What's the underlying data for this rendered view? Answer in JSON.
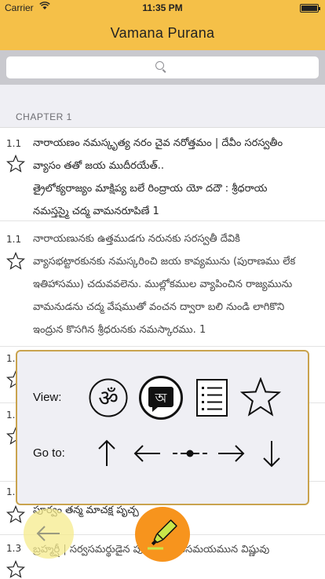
{
  "status_bar": {
    "carrier": "Carrier",
    "time": "11:35 PM"
  },
  "nav": {
    "title": "Vamana Purana"
  },
  "search": {
    "placeholder": ""
  },
  "chapter": {
    "header": "CHAPTER 1"
  },
  "verses": [
    {
      "number": "1.1",
      "lines": [
        "నారాయణం నమస్కృత్య నరం చైవ నరోత్తమం | దేవీం సరస్వతీం",
        "వ్యాసం తతో జయ ముదీరయేత్..",
        "త్రైలోక్యరాజ్యం మాక్షిప్య బలే రింద్రాయ యో దదౌ : శ్రీధరాయ",
        "నమస్తస్మై చద్మ వామనరూపిణే 1"
      ]
    },
    {
      "number": "1.1",
      "lines": [
        "నారాయణునకు ఉత్తముడగు నరునకు సరస్వతీ దేవికి",
        "వ్యాసభట్టారకునకు నమస్కరించి జయ కావ్యమును (పురాణము లేక",
        "ఇతిహాసము) చదువవలెను. ముల్లోకముల వ్యాపించిన రాజ్యమును",
        "వామనుడను చద్మ వేషముతో వంచన ద్వారా బలి నుండి లాగికొని",
        "ఇంద్రున కొసగిన శ్రీధరునకు నమస్కారము. 1"
      ]
    },
    {
      "number": "1.2",
      "lines": []
    },
    {
      "number": "1.1",
      "lines": []
    },
    {
      "number": "1.3",
      "lines": [
        "పూర్వం తన్మ మాచక్ష పృచ్చ"
      ]
    },
    {
      "number": "1.3",
      "lines": [
        "బ్రహ్మర్షీ | సర్వసమర్థుడైన పూర్వపురాణసమయమున విష్ణువు"
      ]
    }
  ],
  "panel": {
    "view_label": "View:",
    "goto_label": "Go to:",
    "view_buttons": [
      "om-icon",
      "translation-icon",
      "list-icon",
      "star-icon"
    ],
    "goto_buttons": [
      "arrow-up-icon",
      "arrow-left-icon",
      "current-position-icon",
      "arrow-right-icon",
      "arrow-down-icon"
    ]
  },
  "colors": {
    "accent": "#f5c048",
    "highlight_fab": "#f7941d",
    "back_fab": "#f5eb8c",
    "panel_border": "#c9a34e"
  }
}
